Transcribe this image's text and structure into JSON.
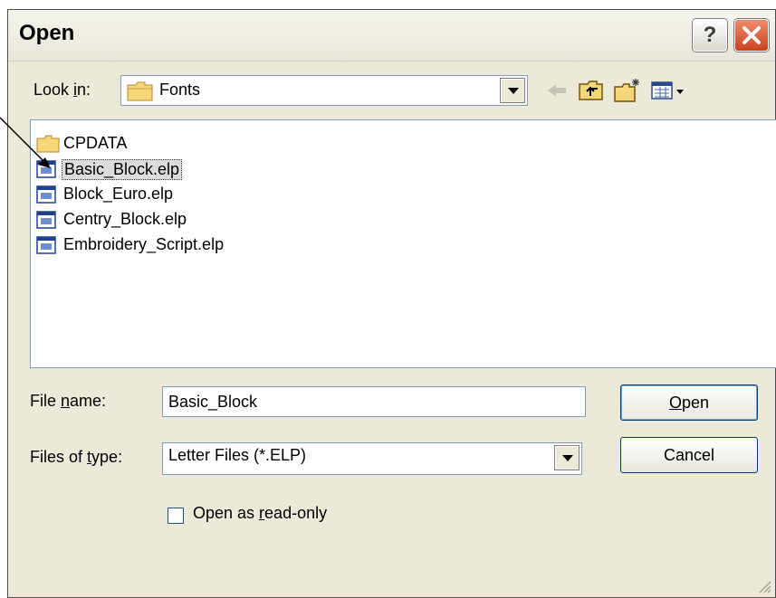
{
  "dialog": {
    "title": "Open",
    "help_glyph": "?"
  },
  "lookin": {
    "label_pre": "Look ",
    "label_key": "i",
    "label_post": "n:",
    "value": "Fonts"
  },
  "toolbar": {
    "icons": [
      "back-arrow-icon",
      "up-folder-icon",
      "new-folder-icon",
      "view-menu-icon"
    ]
  },
  "files": [
    {
      "name": "CPDATA",
      "type": "folder",
      "selected": false
    },
    {
      "name": "Basic_Block.elp",
      "type": "elp",
      "selected": true
    },
    {
      "name": "Block_Euro.elp",
      "type": "elp",
      "selected": false
    },
    {
      "name": "Centry_Block.elp",
      "type": "elp",
      "selected": false
    },
    {
      "name": "Embroidery_Script.elp",
      "type": "elp",
      "selected": false
    }
  ],
  "filename": {
    "label_pre": "File ",
    "label_key": "n",
    "label_post": "ame:",
    "value": "Basic_Block"
  },
  "filetype": {
    "label_pre": "Files of ",
    "label_key": "t",
    "label_post": "ype:",
    "value": "Letter Files (*.ELP)"
  },
  "buttons": {
    "open_key": "O",
    "open_rest": "pen",
    "cancel": "Cancel"
  },
  "readonly": {
    "label_pre": "Open as ",
    "label_key": "r",
    "label_post": "ead-only",
    "checked": false
  },
  "colors": {
    "dialog_bg": "#ece9d8",
    "close_red": "#d5502c",
    "field_border": "#7f9db9"
  }
}
